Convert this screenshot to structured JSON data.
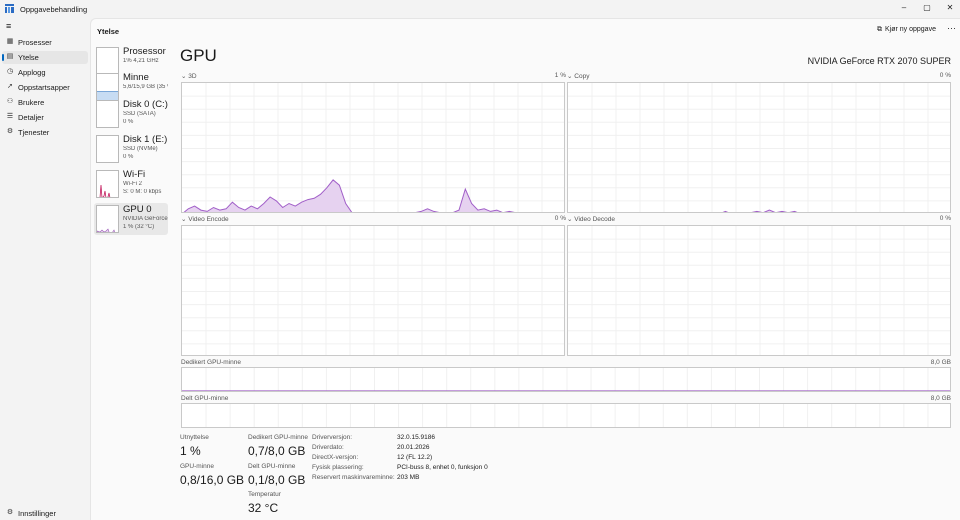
{
  "window": {
    "title": "Oppgavebehandling",
    "buttons": [
      "–",
      "▢",
      "✕"
    ]
  },
  "nav": {
    "items": [
      {
        "label": "Prosesser",
        "icon": "grid-icon"
      },
      {
        "label": "Ytelse",
        "icon": "performance-icon"
      },
      {
        "label": "Applogg",
        "icon": "history-icon"
      },
      {
        "label": "Oppstartsapper",
        "icon": "rocket-icon"
      },
      {
        "label": "Brukere",
        "icon": "users-icon"
      },
      {
        "label": "Detaljer",
        "icon": "list-icon"
      },
      {
        "label": "Tjenester",
        "icon": "services-icon"
      }
    ],
    "active_index": 1,
    "settings": "Innstillinger"
  },
  "header": {
    "title": "Ytelse",
    "run_task": "Kjør ny oppgave",
    "more": "···"
  },
  "devices": [
    {
      "name": "Prosessor",
      "sub1": "1% 4,21 GHz",
      "sub2": ""
    },
    {
      "name": "Minne",
      "sub1": "5,6/15,9 GB (35 %)",
      "sub2": ""
    },
    {
      "name": "Disk 0 (C:)",
      "sub1": "SSD (SATA)",
      "sub2": "0 %"
    },
    {
      "name": "Disk 1 (E:)",
      "sub1": "SSD (NVMe)",
      "sub2": "0 %"
    },
    {
      "name": "Wi-Fi",
      "sub1": "Wi-Fi 2",
      "sub2": "S: 0 M: 0 kbps"
    },
    {
      "name": "GPU 0",
      "sub1": "NVIDIA GeForce RTX 2070 SUPER",
      "sub2": "1 % (32 °C)"
    }
  ],
  "gpu": {
    "title": "GPU",
    "model": "NVIDIA GeForce RTX 2070 SUPER",
    "engines": [
      {
        "name": "3D",
        "percent": "1 %"
      },
      {
        "name": "Copy",
        "percent": "0 %"
      },
      {
        "name": "Video Encode",
        "percent": "0 %"
      },
      {
        "name": "Video Decode",
        "percent": "0 %"
      }
    ],
    "dedicated_label": "Dedikert GPU-minne",
    "dedicated_max": "8,0 GB",
    "shared_label": "Delt GPU-minne",
    "shared_max": "8,0 GB"
  },
  "stats": {
    "utilization_label": "Utnyttelse",
    "utilization": "1 %",
    "gpu_mem_label": "GPU-minne",
    "gpu_mem": "0,8/16,0 GB",
    "dedicated_label": "Dedikert GPU-minne",
    "dedicated": "0,7/8,0 GB",
    "shared_label": "Delt GPU-minne",
    "shared": "0,1/8,0 GB",
    "temp_label": "Temperatur",
    "temp": "32 °C"
  },
  "details": [
    {
      "key": "Driverversjon:",
      "value": "32.0.15.9186"
    },
    {
      "key": "Driverdato:",
      "value": "20.01.2026"
    },
    {
      "key": "DirectX-versjon:",
      "value": "12 (FL 12.2)"
    },
    {
      "key": "Fysisk plassering:",
      "value": "PCI-buss 8, enhet 0, funksjon 0"
    },
    {
      "key": "Reservert maskinvareminne:",
      "value": "203 MB"
    }
  ],
  "series": {
    "3d": [
      0,
      4,
      6,
      3,
      2,
      5,
      3,
      4,
      9,
      5,
      3,
      6,
      4,
      8,
      13,
      10,
      5,
      8,
      6,
      9,
      11,
      12,
      15,
      20,
      26,
      22,
      8,
      1,
      1,
      1,
      1,
      1,
      1,
      1,
      1,
      1,
      1,
      1,
      2,
      4,
      2,
      1,
      1,
      1,
      3,
      19,
      8,
      3,
      4,
      2,
      3,
      1,
      2,
      1,
      1,
      1,
      1,
      1,
      1,
      1,
      1,
      0
    ],
    "copy": [
      0,
      0,
      0,
      0,
      0,
      0,
      0,
      0,
      0,
      0,
      0,
      1,
      1,
      0,
      0,
      0,
      1,
      0,
      0,
      0,
      0,
      0,
      0,
      0,
      0,
      2,
      0,
      1,
      0,
      1,
      2,
      1,
      3,
      1,
      2,
      1,
      2,
      0,
      1,
      1,
      0,
      0,
      0,
      0,
      0,
      0,
      0,
      0,
      0,
      0,
      0,
      0,
      0,
      0,
      0,
      1,
      1,
      1,
      0,
      0,
      0,
      0
    ],
    "dedicated_fraction": 0.0875,
    "shared_fraction": 0.0125
  }
}
